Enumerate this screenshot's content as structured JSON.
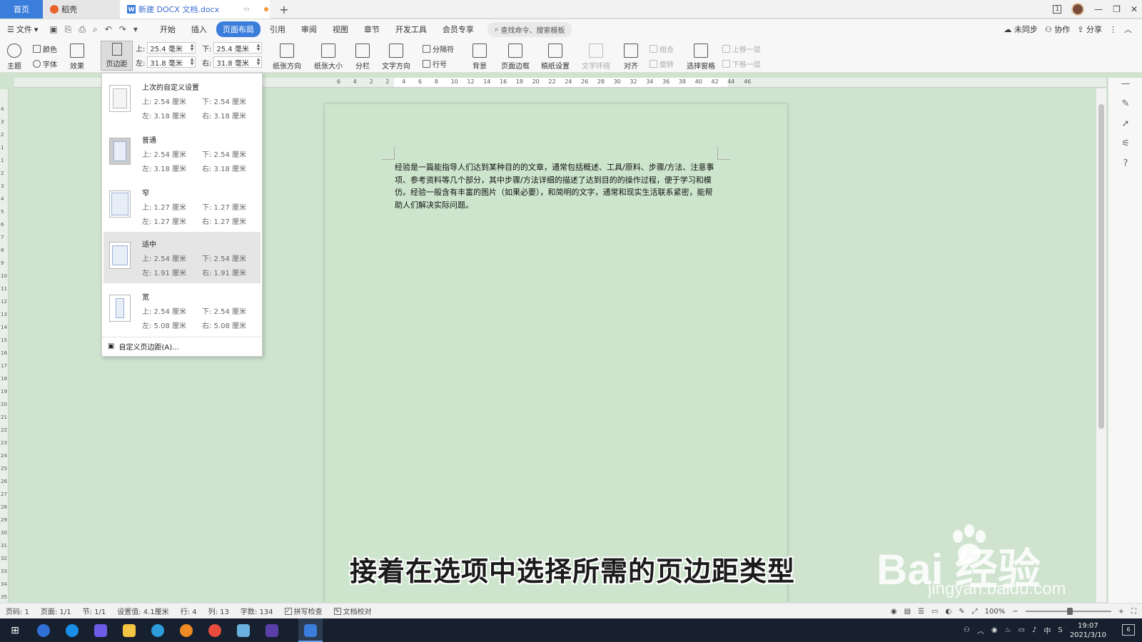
{
  "titlebar": {
    "tabs": [
      {
        "label": "首页"
      },
      {
        "label": "稻壳"
      },
      {
        "label": "新建 DOCX 文档.docx"
      }
    ],
    "page_indicator": "1"
  },
  "menubar": {
    "file_label": "文件",
    "tabs": [
      "开始",
      "插入",
      "页面布局",
      "引用",
      "审阅",
      "视图",
      "章节",
      "开发工具",
      "会员专享"
    ],
    "active_tab": "页面布局",
    "search_placeholder": "查找命令、搜索模板",
    "actions": [
      "未同步",
      "协作",
      "分享"
    ]
  },
  "ribbon": {
    "theme": "主题",
    "color": "颜色",
    "font": "字体",
    "effect": "效果",
    "margins": "页边距",
    "top_label": "上:",
    "top_value": "25.4 毫米",
    "bottom_label": "下:",
    "bottom_value": "25.4 毫米",
    "left_label": "左:",
    "left_value": "31.8 毫米",
    "right_label": "右:",
    "right_value": "31.8 毫米",
    "orientation": "纸张方向",
    "size": "纸张大小",
    "columns": "分栏",
    "text_direction": "文字方向",
    "breaks": "分隔符",
    "line_numbers": "行号",
    "background": "背景",
    "page_border": "页面边框",
    "grid_setup": "稿纸设置",
    "text_wrap": "文字环绕",
    "align": "对齐",
    "group": "组合",
    "rotate": "旋转",
    "selection_pane": "选择窗格",
    "bring_forward": "上移一层",
    "send_backward": "下移一层"
  },
  "ruler": {
    "h_labels": [
      "6",
      "4",
      "2",
      "2",
      "4",
      "6",
      "8",
      "10",
      "12",
      "14",
      "16",
      "18",
      "20",
      "22",
      "24",
      "26",
      "28",
      "30",
      "32",
      "34",
      "36",
      "38",
      "40",
      "42",
      "44",
      "46"
    ],
    "v_labels": [
      "4",
      "3",
      "2",
      "1",
      "1",
      "2",
      "3",
      "4",
      "5",
      "6",
      "7",
      "8",
      "9",
      "10",
      "11",
      "12",
      "13",
      "14",
      "15",
      "16",
      "17",
      "18",
      "19",
      "20",
      "21",
      "22",
      "23",
      "24",
      "25",
      "26",
      "27",
      "28",
      "29",
      "30",
      "31",
      "32",
      "33",
      "34",
      "35"
    ]
  },
  "margin_dropdown": {
    "presets": [
      {
        "name": "上次的自定义设置",
        "top": "上: 2.54 厘米",
        "bottom": "下: 2.54 厘米",
        "left": "左: 3.18 厘米",
        "right": "右: 3.18 厘米"
      },
      {
        "name": "普通",
        "top": "上: 2.54 厘米",
        "bottom": "下: 2.54 厘米",
        "left": "左: 3.18 厘米",
        "right": "右: 3.18 厘米"
      },
      {
        "name": "窄",
        "top": "上: 1.27 厘米",
        "bottom": "下: 1.27 厘米",
        "left": "左: 1.27 厘米",
        "right": "右: 1.27 厘米"
      },
      {
        "name": "适中",
        "top": "上: 2.54 厘米",
        "bottom": "下: 2.54 厘米",
        "left": "左: 1.91 厘米",
        "right": "右: 1.91 厘米"
      },
      {
        "name": "宽",
        "top": "上: 2.54 厘米",
        "bottom": "下: 2.54 厘米",
        "left": "左: 5.08 厘米",
        "right": "右: 5.08 厘米"
      }
    ],
    "custom_label": "自定义页边距(A)..."
  },
  "document": {
    "body": "经验是一篇能指导人们达到某种目的的文章，通常包括概述、工具/原料、步骤/方法、注意事项、参考资料等几个部分，其中步骤/方法详细的描述了达到目的的操作过程，便于学习和模仿。经验一般含有丰富的图片（如果必要），和简明的文字，通常和现实生活联系紧密，能帮助人们解决实际问题。"
  },
  "caption": "接着在选项中选择所需的页边距类型",
  "watermark": {
    "main": "Bai  经验",
    "sub": "jingyan.baidu.com"
  },
  "statusbar": {
    "page_num": "页码: 1",
    "pages": "页面: 1/1",
    "section": "节: 1/1",
    "setting": "设置值: 4.1厘米",
    "row": "行: 4",
    "col": "列: 13",
    "words": "字数: 134",
    "spell": "拼写检查",
    "proof": "文档校对",
    "zoom": "100%"
  },
  "taskbar": {
    "time": "19:07",
    "date": "2021/3/10",
    "ime": "中",
    "notifications": "6"
  }
}
